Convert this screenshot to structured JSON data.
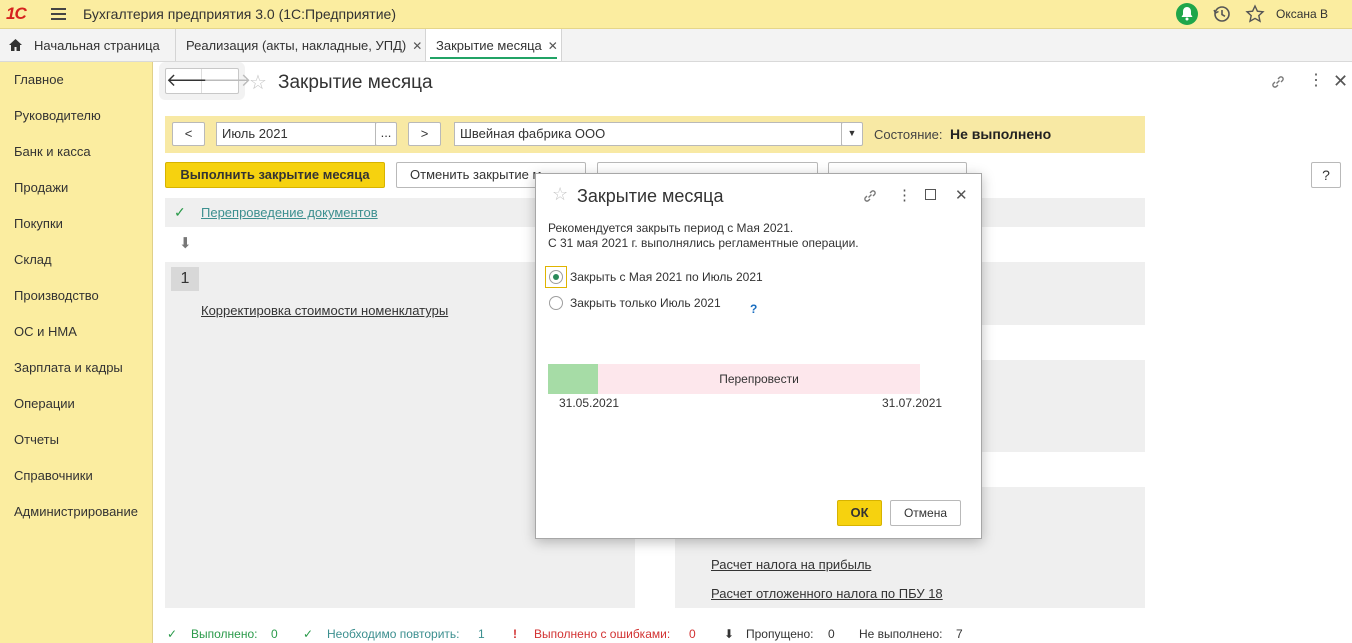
{
  "app": {
    "title": "Бухгалтерия предприятия 3.0  (1С:Предприятие)",
    "logo_text": "1С",
    "user": "Оксана В",
    "icons": [
      "menu-icon",
      "bell-icon",
      "history-icon",
      "star-icon"
    ]
  },
  "tabs": [
    {
      "label": "Начальная страница",
      "icon": "home-icon"
    },
    {
      "label": "Реализация (акты, накладные, УПД)",
      "closable": true
    },
    {
      "label": "Закрытие месяца",
      "closable": true,
      "active": true
    }
  ],
  "sidebar": {
    "items": [
      {
        "label": "Главное"
      },
      {
        "label": "Руководителю"
      },
      {
        "label": "Банк и касса"
      },
      {
        "label": "Продажи"
      },
      {
        "label": "Покупки"
      },
      {
        "label": "Склад"
      },
      {
        "label": "Производство"
      },
      {
        "label": "ОС и НМА"
      },
      {
        "label": "Зарплата и кадры"
      },
      {
        "label": "Операции"
      },
      {
        "label": "Отчеты"
      },
      {
        "label": "Справочники"
      },
      {
        "label": "Администрирование"
      }
    ]
  },
  "form": {
    "title": "Закрытие месяца",
    "prev_label": "<",
    "next_label": ">",
    "period": "Июль 2021",
    "period_select": "...",
    "organization": "Швейная фабрика ООО",
    "state_label": "Состояние:",
    "state_value": "Не выполнено",
    "run_button": "Выполнить закрытие месяца",
    "cancel_button": "Отменить закрытие м",
    "help": "?",
    "repost_link": "Перепроведение документов",
    "step_number": "1",
    "step1_link": "Корректировка стоимости номенклатуры",
    "tax_link": "Расчет налога на прибыль",
    "deferred_tax_link": "Расчет отложенного налога по ПБУ 18"
  },
  "status": {
    "done_label": "Выполнено:",
    "done_count": "0",
    "repeat_label": "Необходимо повторить:",
    "repeat_count": "1",
    "errors_label": "Выполнено с ошибками:",
    "errors_count": "0",
    "skipped_label": "Пропущено:",
    "skipped_count": "0",
    "not_done_label": "Не выполнено:",
    "not_done_count": "7"
  },
  "dialog": {
    "title": "Закрытие месяца",
    "line1": "Рекомендуется закрыть период с Мая 2021.",
    "line2": "С 31 мая 2021 г. выполнялись регламентные операции.",
    "option1": "Закрыть с Мая 2021 по Июль 2021",
    "option2": "Закрыть только Июль 2021",
    "option_selected": 1,
    "help": "?",
    "bar_label": "Перепровести",
    "date_start": "31.05.2021",
    "date_end": "31.07.2021",
    "ok": "ОК",
    "cancel": "Отмена"
  },
  "colors": {
    "accent_yellow": "#f6d20f",
    "panel_yellow": "#fbeda0",
    "green": "#2a9a4a",
    "error_red": "#d23232",
    "link_teal": "#3c8f8f"
  }
}
